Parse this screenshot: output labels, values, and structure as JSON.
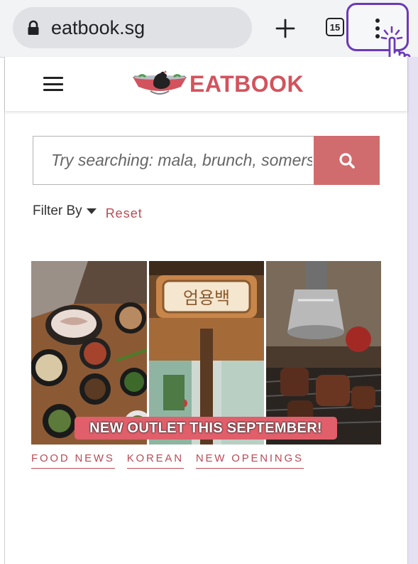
{
  "browser": {
    "url": "eatbook.sg",
    "tab_count": "15",
    "icons": {
      "lock": "lock-icon",
      "new_tab": "plus-icon",
      "menu": "kebab-menu-icon",
      "tap": "tap-hand-icon"
    }
  },
  "site": {
    "logo_text": "EATBOOK",
    "search": {
      "placeholder": "Try searching: mala, brunch, somerset...",
      "button_icon": "search-icon"
    },
    "filter": {
      "label": "Filter By",
      "reset_label": "Reset"
    },
    "article": {
      "image_banner": "NEW OUTLET THIS SEPTEMBER!",
      "signboard_text": "엄용백",
      "tags": [
        {
          "label": "FOOD NEWS"
        },
        {
          "label": "KOREAN"
        },
        {
          "label": "NEW OPENINGS"
        }
      ]
    }
  },
  "colors": {
    "brand": "#d2535d",
    "search_button": "#d16c6e",
    "highlight": "#6b39b8",
    "tag_text": "#b94b55"
  }
}
